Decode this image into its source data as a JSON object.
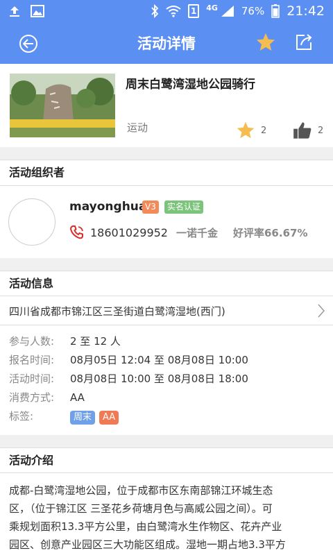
{
  "status_bar": {
    "network": "4G",
    "sim_badge": "1",
    "battery": "76%",
    "time": "21:42"
  },
  "header": {
    "title": "活动详情"
  },
  "activity": {
    "title": "周末白鹭湾湿地公园骑行",
    "category": "运动",
    "favorites": "2",
    "likes": "2"
  },
  "organizer_section": {
    "heading": "活动组织者",
    "name": "mayonghua",
    "level_badge": "V3",
    "verify_badge": "实名认证",
    "phone": "18601029952",
    "promise": "一诺千金",
    "rating": "好评率66.67%"
  },
  "info_section": {
    "heading": "活动信息",
    "address": "四川省成都市锦江区三圣街道白鹭湾湿地(西门)",
    "participants_label": "参与人数:",
    "participants": "2 至 12 人",
    "signup_label": "报名时间:",
    "signup": "08月05日 12:04 至 08月08日 10:00",
    "time_label": "活动时间:",
    "time": "08月08日 10:00 至 08月08日 18:00",
    "payment_label": "消费方式:",
    "payment": "AA",
    "tags_label": "标签:",
    "tags": [
      "周末",
      "AA"
    ]
  },
  "intro_section": {
    "heading": "活动介绍",
    "lines": [
      "成都-白鹭湾湿地公园，位于成都市区东南部锦江环城生态",
      "区，（位于锦江区 三圣花乡荷塘月色与高威公园之间）。可",
      "乘规划面积13.3平方公里，由白鹭湾水生作物区、花卉产业",
      "园区、创意产业园区三大功能区组成。湿地一期占地3.3平方"
    ]
  },
  "colors": {
    "primary": "#5b8ff2",
    "star": "#f5bd4f",
    "level_badge": "#f28a5a",
    "verify_badge": "#7cc47b",
    "tag_weekend": "#6fa0e8",
    "tag_aa": "#f07a55",
    "phone_icon": "#d9302a"
  }
}
